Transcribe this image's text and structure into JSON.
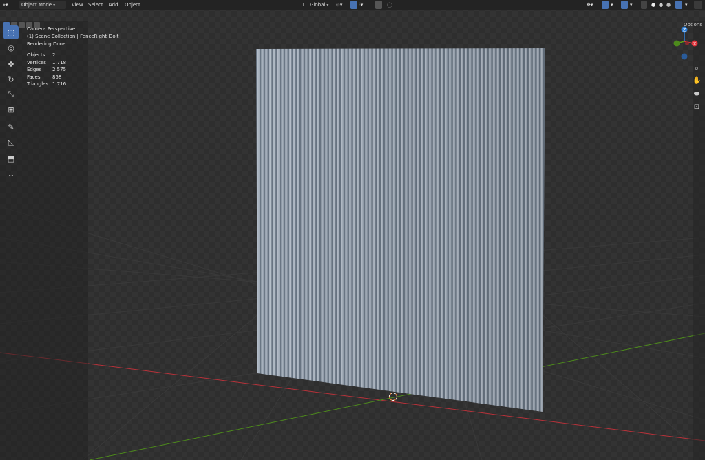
{
  "header": {
    "mode": "Object Mode",
    "menu": [
      "View",
      "Select",
      "Add",
      "Object"
    ],
    "orientation": "Global"
  },
  "options_label": "Options",
  "viewport_info": {
    "line1": "Camera Perspective",
    "line2": "(1) Scene Collection | FenceRight_Bolt",
    "line3": "Rendering Done"
  },
  "stats": [
    {
      "label": "Objects",
      "value": "2"
    },
    {
      "label": "Vertices",
      "value": "1,718"
    },
    {
      "label": "Edges",
      "value": "2,575"
    },
    {
      "label": "Faces",
      "value": "858"
    },
    {
      "label": "Triangles",
      "value": "1,716"
    }
  ],
  "gizmo": {
    "x": "X",
    "y": "Y",
    "z": "Z"
  },
  "colors": {
    "active_tool": "#4772b3",
    "x_axis": "#e0343c",
    "y_axis": "#5ea316",
    "z_axis": "#2f7fd6",
    "panel": "#a9b4c0"
  },
  "tools": [
    "select-box-icon",
    "cursor-icon",
    "move-icon",
    "rotate-icon",
    "scale-icon",
    "transform-icon",
    "annotate-icon",
    "measure-icon",
    "add-cube-icon",
    "curve-icon"
  ]
}
